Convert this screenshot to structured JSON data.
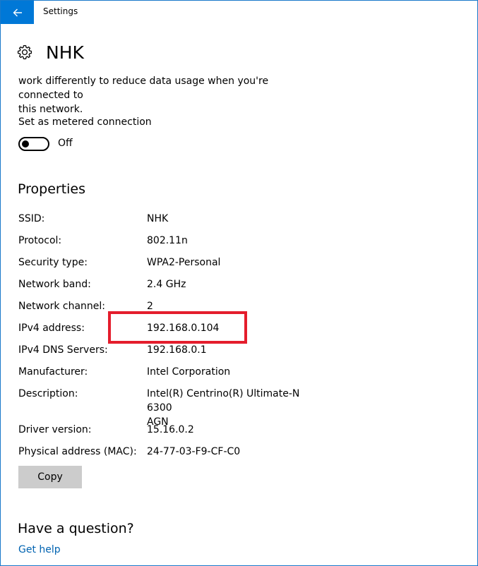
{
  "window": {
    "title": "Settings",
    "accent_color": "#0078d7"
  },
  "header": {
    "icon": "gear-icon",
    "title": "NHK"
  },
  "metered": {
    "description_line1": "work differently to reduce data usage when you're connected to",
    "description_line2": "this network.",
    "label": "Set as metered connection",
    "toggle_state": "Off"
  },
  "properties": {
    "section_title": "Properties",
    "rows": [
      {
        "key": "SSID:",
        "value": "NHK"
      },
      {
        "key": "Protocol:",
        "value": "802.11n"
      },
      {
        "key": "Security type:",
        "value": "WPA2-Personal"
      },
      {
        "key": "Network band:",
        "value": "2.4 GHz"
      },
      {
        "key": "Network channel:",
        "value": "2"
      },
      {
        "key": "IPv4 address:",
        "value": "192.168.0.104"
      },
      {
        "key": "IPv4 DNS Servers:",
        "value": "192.168.0.1"
      },
      {
        "key": "Manufacturer:",
        "value": "Intel Corporation"
      },
      {
        "key": "Description:",
        "value": "Intel(R) Centrino(R) Ultimate-N 6300",
        "value_line2": "AGN"
      },
      {
        "key": "Driver version:",
        "value": "15.16.0.2"
      },
      {
        "key": "Physical address (MAC):",
        "value": "24-77-03-F9-CF-C0"
      }
    ],
    "copy_label": "Copy",
    "highlight_color": "#e41d2c"
  },
  "help": {
    "title": "Have a question?",
    "link": "Get help",
    "link_color": "#0063b1"
  }
}
